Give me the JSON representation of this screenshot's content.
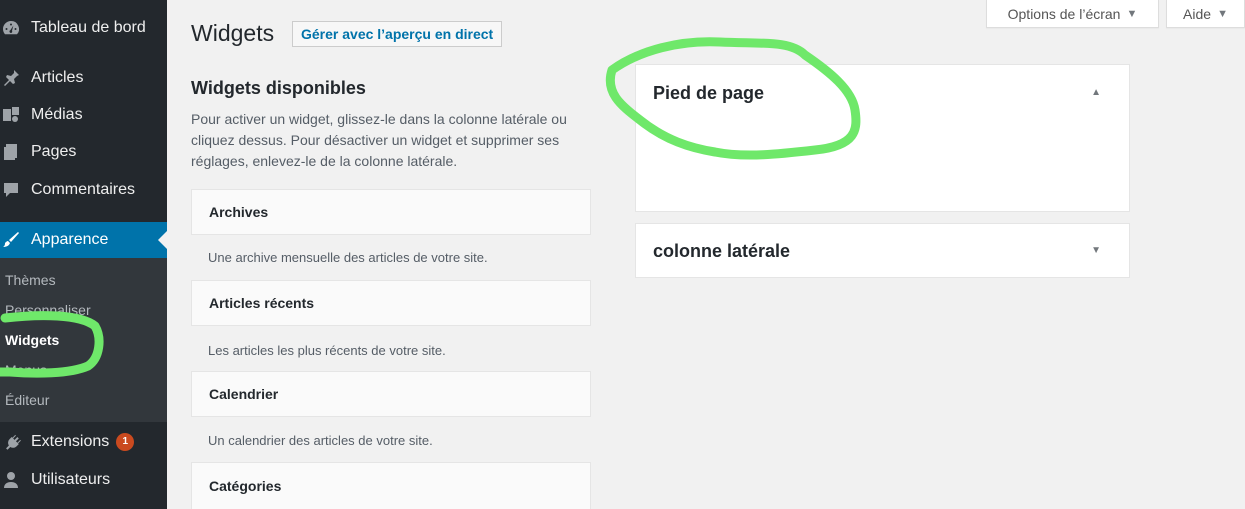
{
  "sidebar": {
    "menu": [
      {
        "label": "Tableau de bord",
        "icon": "dashboard-icon"
      },
      {
        "label": "Articles",
        "icon": "pushpin-icon"
      },
      {
        "label": "Médias",
        "icon": "media-icon"
      },
      {
        "label": "Pages",
        "icon": "pages-icon"
      },
      {
        "label": "Commentaires",
        "icon": "comment-icon"
      },
      {
        "label": "Apparence",
        "icon": "brush-icon"
      },
      {
        "label": "Extensions",
        "icon": "plugin-icon",
        "badge": "1"
      },
      {
        "label": "Utilisateurs",
        "icon": "user-icon"
      }
    ],
    "submenu": [
      "Thèmes",
      "Personnaliser",
      "Widgets",
      "Menus",
      "Éditeur"
    ]
  },
  "screen_meta": {
    "options_label": "Options de l’écran",
    "help_label": "Aide"
  },
  "page": {
    "title": "Widgets",
    "action_label": "Gérer avec l’aperçu en direct"
  },
  "available": {
    "heading": "Widgets disponibles",
    "description": "Pour activer un widget, glissez-le dans la colonne latérale ou cliquez dessus. Pour désactiver un widget et supprimer ses réglages, enlevez-le de la colonne latérale.",
    "widgets": [
      {
        "name": "Archives",
        "desc": "Une archive mensuelle des articles de votre site."
      },
      {
        "name": "Articles récents",
        "desc": "Les articles les plus récents de votre site."
      },
      {
        "name": "Calendrier",
        "desc": "Un calendrier des articles de votre site."
      },
      {
        "name": "Catégories",
        "desc": ""
      }
    ]
  },
  "sidebars": [
    {
      "name": "Pied de page",
      "expanded": true
    },
    {
      "name": "colonne latérale",
      "expanded": false
    }
  ],
  "colors": {
    "admin_bg": "#23282d",
    "submenu_bg": "#32373c",
    "accent": "#0073aa",
    "badge": "#ca4a1f",
    "annotation": "#6fe86a"
  }
}
